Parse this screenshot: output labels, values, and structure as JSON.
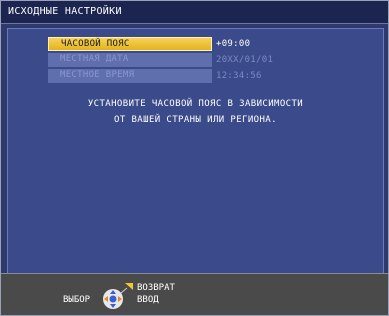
{
  "header": {
    "title": "ИСХОДНЫЕ НАСТРОЙКИ"
  },
  "menu": {
    "items": [
      {
        "label": "ЧАСОВОЙ ПОЯС",
        "value": "+09:00"
      },
      {
        "label": "МЕСТНАЯ ДАТА",
        "value": "20XX/01/01"
      },
      {
        "label": "МЕСТНОЕ ВРЕМЯ",
        "value": "12:34:56"
      }
    ]
  },
  "description": {
    "line1": "УСТАНОВИТЕ ЧАСОВОЙ ПОЯС В ЗАВИСИМОСТИ",
    "line2": "ОТ ВАШЕЙ СТРАНЫ ИЛИ РЕГИОНА."
  },
  "footer": {
    "select_label": "ВЫБОР",
    "back_label": "ВОЗВРАТ",
    "enter_label": "ВВОД",
    "icon": "remote-control-buttons-icon"
  },
  "colors": {
    "highlight": "#e3b31c",
    "panel": "#3a4a8a",
    "titlebar": "#1c2450",
    "footer": "#4a4a4a"
  }
}
